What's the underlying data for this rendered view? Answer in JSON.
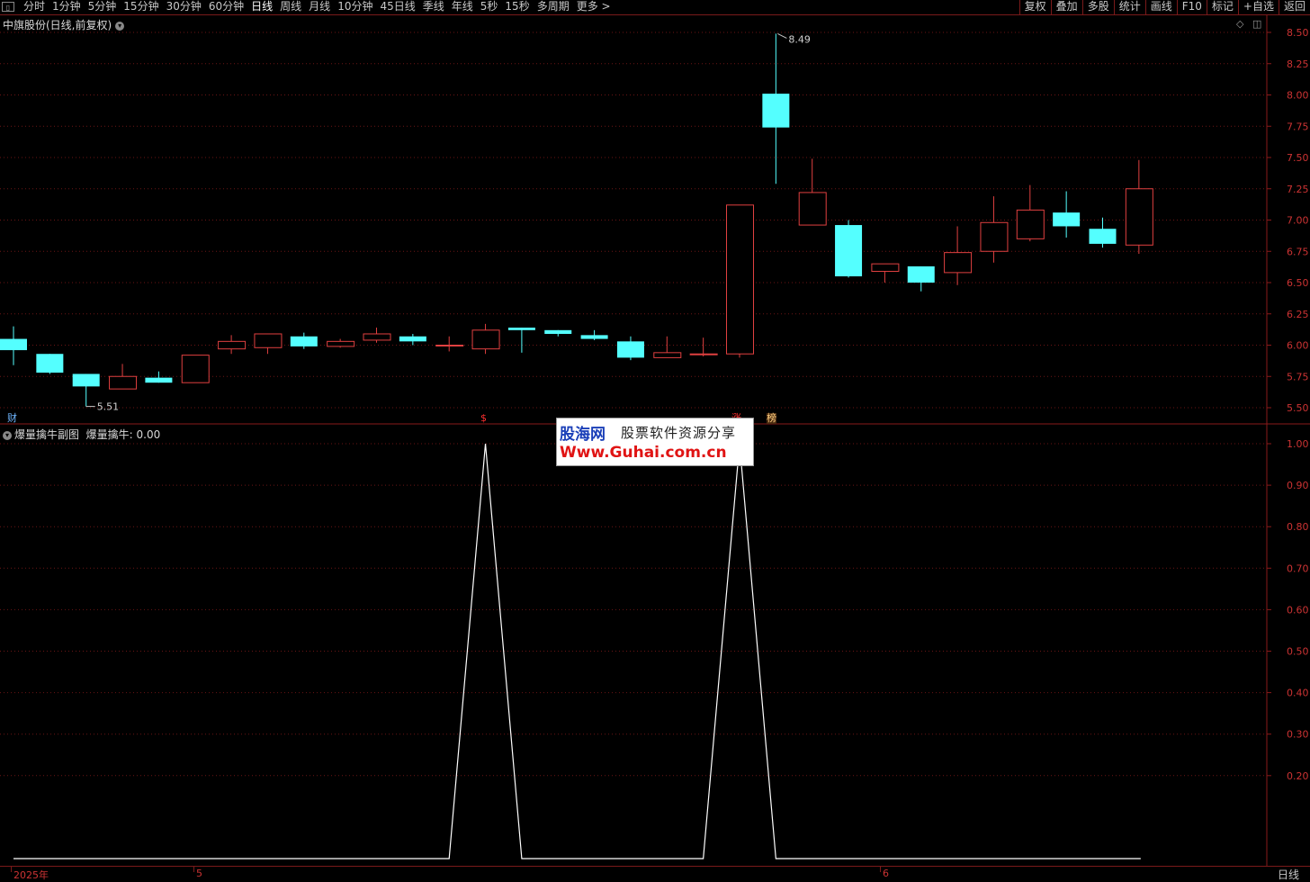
{
  "toolbar": {
    "periods": [
      "分时",
      "1分钟",
      "5分钟",
      "15分钟",
      "30分钟",
      "60分钟",
      "日线",
      "周线",
      "月线",
      "10分钟",
      "45日线",
      "季线",
      "年线",
      "5秒",
      "15秒",
      "多周期",
      "更多 >"
    ],
    "active_period": "日线",
    "tools": [
      "复权",
      "叠加",
      "多股",
      "统计",
      "画线",
      "F10",
      "标记",
      "+自选",
      "返回"
    ]
  },
  "stock_title": "中旗股份(日线,前复权)",
  "indicator": {
    "title": "爆量擒牛副图",
    "value_text": "爆量擒牛: 0.00"
  },
  "price_axis": {
    "labels": [
      "8.50",
      "8.25",
      "8.00",
      "7.75",
      "7.50",
      "7.25",
      "7.00",
      "6.75",
      "6.50",
      "6.25",
      "6.00",
      "5.75",
      "5.50"
    ]
  },
  "indicator_axis": {
    "labels": [
      "1.00",
      "0.90",
      "0.80",
      "0.70",
      "0.60",
      "0.50",
      "0.40",
      "0.30",
      "0.20"
    ]
  },
  "annotations": {
    "high_label": "8.49",
    "low_label": "5.51"
  },
  "markers": {
    "cai": "财",
    "s": "$",
    "zhang": "涨",
    "bang": "榜"
  },
  "watermark": {
    "logo": "股海网",
    "slogan": "股票软件资源分享",
    "url": "Www.Guhai.com.cn"
  },
  "date_axis": {
    "labels": [
      "2025年",
      "5",
      "6"
    ]
  },
  "period_indicator": "日线",
  "colors": {
    "up": "#e04040",
    "down": "#54ffff",
    "grid": "#6a1515",
    "axis_text": "#cc3333",
    "indicator_line": "#ffffff"
  },
  "chart_data": {
    "type": "candlestick",
    "price_range": [
      5.45,
      8.55
    ],
    "candles": [
      {
        "open": 6.05,
        "close": 5.96,
        "high": 6.15,
        "low": 5.84
      },
      {
        "open": 5.93,
        "close": 5.78,
        "high": 5.93,
        "low": 5.77
      },
      {
        "open": 5.77,
        "close": 5.67,
        "high": 5.77,
        "low": 5.51
      },
      {
        "open": 5.65,
        "close": 5.75,
        "high": 5.85,
        "low": 5.65
      },
      {
        "open": 5.74,
        "close": 5.7,
        "high": 5.79,
        "low": 5.7
      },
      {
        "open": 5.7,
        "close": 5.92,
        "high": 5.92,
        "low": 5.7
      },
      {
        "open": 5.97,
        "close": 6.03,
        "high": 6.08,
        "low": 5.93
      },
      {
        "open": 5.98,
        "close": 6.09,
        "high": 6.09,
        "low": 5.93
      },
      {
        "open": 6.07,
        "close": 5.99,
        "high": 6.1,
        "low": 5.97
      },
      {
        "open": 5.99,
        "close": 6.03,
        "high": 6.05,
        "low": 5.98
      },
      {
        "open": 6.04,
        "close": 6.09,
        "high": 6.14,
        "low": 6.02
      },
      {
        "open": 6.07,
        "close": 6.03,
        "high": 6.09,
        "low": 6.0
      },
      {
        "open": 6.0,
        "close": 6.0,
        "high": 6.07,
        "low": 5.95
      },
      {
        "open": 5.97,
        "close": 6.12,
        "high": 6.17,
        "low": 5.93
      },
      {
        "open": 6.14,
        "close": 6.12,
        "high": 6.14,
        "low": 5.94
      },
      {
        "open": 6.12,
        "close": 6.09,
        "high": 6.12,
        "low": 6.07
      },
      {
        "open": 6.08,
        "close": 6.05,
        "high": 6.12,
        "low": 6.04
      },
      {
        "open": 6.03,
        "close": 5.9,
        "high": 6.07,
        "low": 5.88
      },
      {
        "open": 5.9,
        "close": 5.94,
        "high": 6.07,
        "low": 5.9
      },
      {
        "open": 5.93,
        "close": 5.93,
        "high": 6.06,
        "low": 5.91
      },
      {
        "open": 5.93,
        "close": 7.12,
        "high": 7.12,
        "low": 5.9
      },
      {
        "open": 8.01,
        "close": 7.74,
        "high": 8.49,
        "low": 7.29
      },
      {
        "open": 6.96,
        "close": 7.22,
        "high": 7.49,
        "low": 6.96
      },
      {
        "open": 6.96,
        "close": 6.55,
        "high": 7.0,
        "low": 6.54
      },
      {
        "open": 6.59,
        "close": 6.65,
        "high": 6.65,
        "low": 6.5
      },
      {
        "open": 6.63,
        "close": 6.5,
        "high": 6.63,
        "low": 6.43
      },
      {
        "open": 6.58,
        "close": 6.74,
        "high": 6.95,
        "low": 6.48
      },
      {
        "open": 6.75,
        "close": 6.98,
        "high": 7.19,
        "low": 6.66
      },
      {
        "open": 6.85,
        "close": 7.08,
        "high": 7.28,
        "low": 6.83
      },
      {
        "open": 7.06,
        "close": 6.95,
        "high": 7.23,
        "low": 6.86
      },
      {
        "open": 6.93,
        "close": 6.81,
        "high": 7.02,
        "low": 6.78
      },
      {
        "open": 6.8,
        "close": 7.25,
        "high": 7.48,
        "low": 6.73
      }
    ],
    "indicator": {
      "name": "爆量擒牛",
      "range": [
        0,
        1.0
      ],
      "values": [
        0,
        0,
        0,
        0,
        0,
        0,
        0,
        0,
        0,
        0,
        0,
        0,
        0,
        1,
        0,
        0,
        0,
        0,
        0,
        0,
        1,
        0,
        0,
        0,
        0,
        0,
        0,
        0,
        0,
        0,
        0,
        0
      ]
    }
  }
}
